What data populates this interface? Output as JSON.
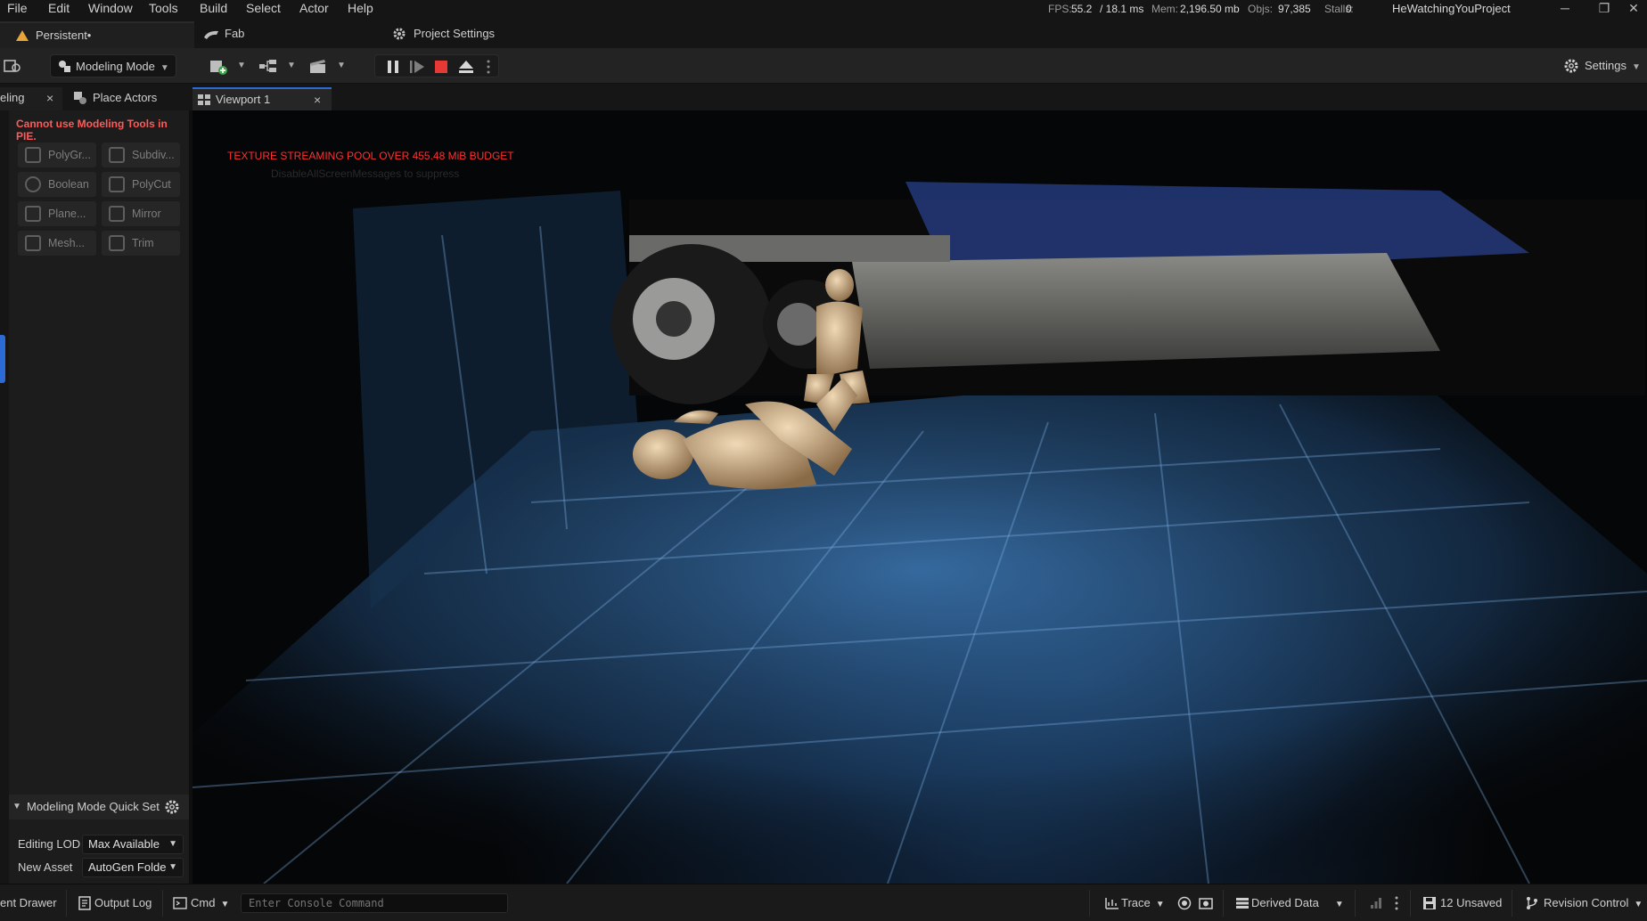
{
  "menu": {
    "items": [
      "File",
      "Edit",
      "Window",
      "Tools",
      "Build",
      "Select",
      "Actor",
      "Help"
    ]
  },
  "stats": {
    "fps_label": "FPS:",
    "fps": "55.2",
    "ms": "/ 18.1 ms",
    "mem_label": "Mem:",
    "mem": "2,196.50 mb",
    "objs_label": "Objs:",
    "objs": "97,385",
    "stalls_label": "Stalls:",
    "stalls": "0"
  },
  "project_name": "HeWatchingYouProject",
  "window_controls": {
    "minimize": "─",
    "restore": "❐",
    "close": "✕"
  },
  "doc_tabs": {
    "level": "Persistent•",
    "fab": "Fab",
    "project_settings": "Project Settings"
  },
  "toolbar": {
    "mode": "Modeling Mode",
    "settings": "Settings"
  },
  "panel_tabs": {
    "modeling": "eling",
    "close": "×",
    "place_actors": "Place Actors",
    "viewport": "Viewport 1"
  },
  "left_panel": {
    "warning": "Cannot use Modeling Tools in PIE.",
    "tools": [
      "PolyGr...",
      "Subdiv...",
      "Boolean",
      "PolyCut",
      "Plane...",
      "Mirror",
      "Mesh...",
      "Trim"
    ],
    "quick_settings_title": "Modeling Mode Quick Set",
    "props": [
      {
        "label": "Editing LOD",
        "value": "Max Available"
      },
      {
        "label": "New Asset",
        "value": "AutoGen Folder"
      }
    ]
  },
  "viewport": {
    "message": "TEXTURE STREAMING POOL OVER 455.48 MiB BUDGET",
    "message2": "DisableAllScreenMessages to suppress"
  },
  "status_bar": {
    "content_drawer": "ent Drawer",
    "output_log": "Output Log",
    "cmd": "Cmd",
    "console_placeholder": "Enter Console Command",
    "trace": "Trace",
    "derived_data": "Derived Data",
    "unsaved": "12 Unsaved",
    "revision_control": "Revision Control"
  },
  "colors": {
    "accent": "#2c6bd6",
    "warning": "#ff5a5a",
    "stop": "#e53935"
  }
}
